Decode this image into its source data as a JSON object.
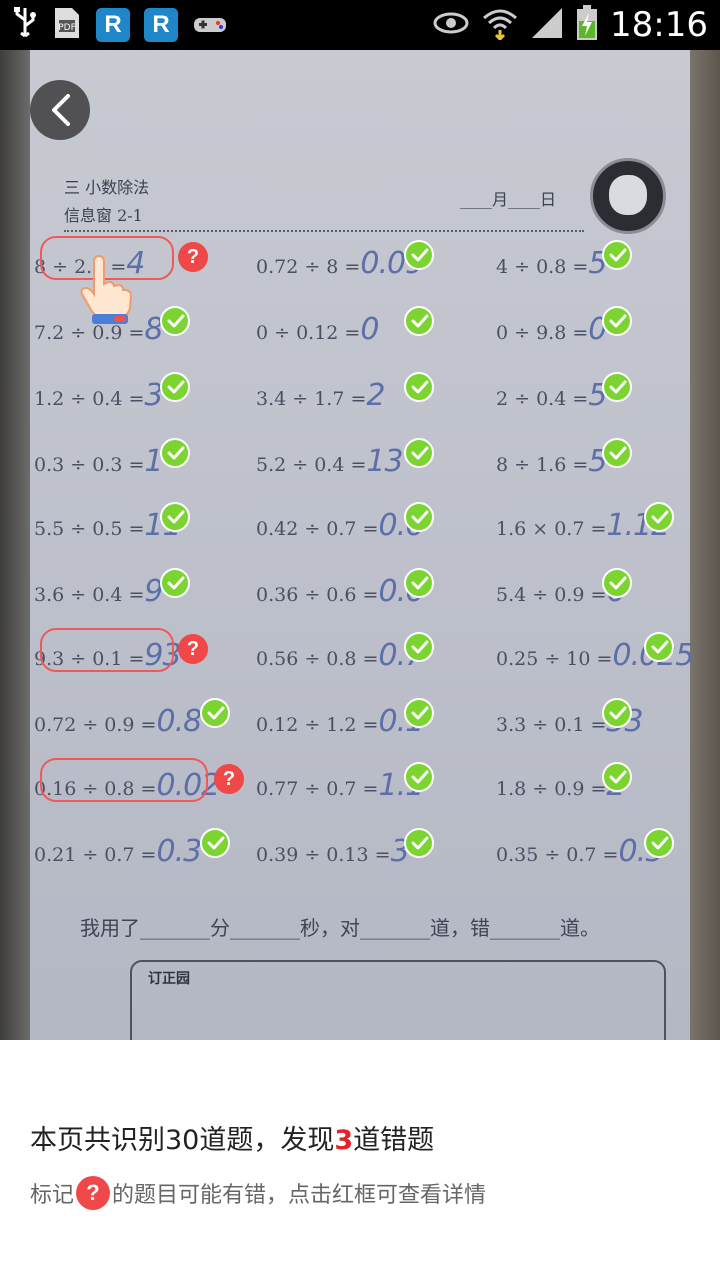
{
  "status_bar": {
    "time": "18:16",
    "left_icons": [
      "usb-icon",
      "document-icon",
      "r-app-icon",
      "r-app-icon",
      "game-controller-icon"
    ],
    "right_icons": [
      "eye-icon",
      "wifi-icon",
      "signal-icon",
      "battery-charging-icon"
    ],
    "r_letter": "R"
  },
  "worksheet": {
    "title": "三  小数除法",
    "subtitle": "信息窗 2-1",
    "date_label": "____月____日",
    "footer_line": "我用了_______分_______秒，对_______道，错_______道。",
    "correction_label": "订正园",
    "columns": [
      [
        {
          "expr": "8 ÷ 2.2 =",
          "answer": "4",
          "status": "error"
        },
        {
          "expr": "7.2 ÷ 0.9 =",
          "answer": "8",
          "status": "correct"
        },
        {
          "expr": "1.2 ÷ 0.4 =",
          "answer": "3",
          "status": "correct"
        },
        {
          "expr": "0.3 ÷ 0.3 =",
          "answer": "1",
          "status": "correct"
        },
        {
          "expr": "5.5 ÷ 0.5 =",
          "answer": "11",
          "status": "correct"
        },
        {
          "expr": "3.6 ÷ 0.4 =",
          "answer": "9",
          "status": "correct"
        },
        {
          "expr": "9.3 ÷ 0.1 =",
          "answer": "93",
          "status": "error"
        },
        {
          "expr": "0.72 ÷ 0.9 =",
          "answer": "0.8",
          "status": "correct"
        },
        {
          "expr": "0.16 ÷ 0.8 =",
          "answer": "0.02",
          "status": "error"
        },
        {
          "expr": "0.21 ÷ 0.7 =",
          "answer": "0.3",
          "status": "correct"
        }
      ],
      [
        {
          "expr": "0.72 ÷ 8 =",
          "answer": "0.09",
          "status": "correct"
        },
        {
          "expr": "0 ÷ 0.12 =",
          "answer": "0",
          "status": "correct"
        },
        {
          "expr": "3.4 ÷ 1.7 =",
          "answer": "2",
          "status": "correct"
        },
        {
          "expr": "5.2 ÷ 0.4 =",
          "answer": "13",
          "status": "correct"
        },
        {
          "expr": "0.42 ÷ 0.7 =",
          "answer": "0.6",
          "status": "correct"
        },
        {
          "expr": "0.36 ÷ 0.6 =",
          "answer": "0.6",
          "status": "correct"
        },
        {
          "expr": "0.56 ÷ 0.8 =",
          "answer": "0.7",
          "status": "correct"
        },
        {
          "expr": "0.12 ÷ 1.2 =",
          "answer": "0.1",
          "status": "correct"
        },
        {
          "expr": "0.77 ÷ 0.7 =",
          "answer": "1.1",
          "status": "correct"
        },
        {
          "expr": "0.39 ÷ 0.13 =",
          "answer": "3",
          "status": "correct"
        }
      ],
      [
        {
          "expr": "4 ÷ 0.8 =",
          "answer": "5",
          "status": "correct"
        },
        {
          "expr": "0 ÷ 9.8 =",
          "answer": "0",
          "status": "correct"
        },
        {
          "expr": "2 ÷ 0.4 =",
          "answer": "5",
          "status": "correct"
        },
        {
          "expr": "8 ÷ 1.6 =",
          "answer": "5",
          "status": "correct"
        },
        {
          "expr": "1.6 × 0.7 =",
          "answer": "1.12",
          "status": "correct"
        },
        {
          "expr": "5.4 ÷ 0.9 =",
          "answer": "6",
          "status": "correct"
        },
        {
          "expr": "0.25 ÷ 10 =",
          "answer": "0.025",
          "status": "correct"
        },
        {
          "expr": "3.3 ÷ 0.1 =",
          "answer": "33",
          "status": "correct"
        },
        {
          "expr": "1.8 ÷ 0.9 =",
          "answer": "2",
          "status": "correct"
        },
        {
          "expr": "0.35 ÷ 0.7 =",
          "answer": "0.5",
          "status": "correct"
        }
      ]
    ]
  },
  "summary": {
    "prefix": "本页共识别30道题，发现",
    "count": "3",
    "suffix": "道错题"
  },
  "hint": {
    "prefix": "标记",
    "icon_text": "?",
    "suffix": "的题目可能有错，点击红框可查看详情"
  },
  "colors": {
    "correct": "#7bd42f",
    "error": "#f04848",
    "accent_count": "#e8202a"
  }
}
